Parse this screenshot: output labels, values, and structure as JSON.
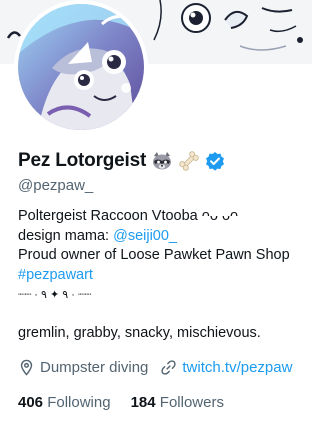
{
  "profile": {
    "display_name": "Pez Lotorgeist",
    "handle": "@pezpaw_",
    "bio": {
      "line1": "Poltergeist Raccoon Vtooba",
      "line1_suffix": "ᴖᴗ ᴗᴖ",
      "line2_prefix": "design mama: ",
      "line2_mention": "@seiji00_",
      "line3": "Proud owner of Loose Pawket Pawn Shop",
      "line4": "#pezpawart",
      "line5": "┈┈ · ٩ ✦ ٩ · ┈┈",
      "line7": "gremlin, grabby, snacky, mischievous."
    },
    "location": "Dumpster diving",
    "website": "twitch.tv/pezpaw",
    "following_count": "406",
    "following_label": "Following",
    "followers_count": "184",
    "followers_label": "Followers"
  },
  "icons": {
    "name_emoji_1": "raccoon-icon",
    "name_emoji_2": "bone-icon",
    "verified": "verified-badge-icon",
    "location": "location-pin-icon",
    "link": "link-icon"
  },
  "colors": {
    "accent": "#1d9bf0",
    "secondary_text": "#536471",
    "primary_text": "#0f1419"
  }
}
